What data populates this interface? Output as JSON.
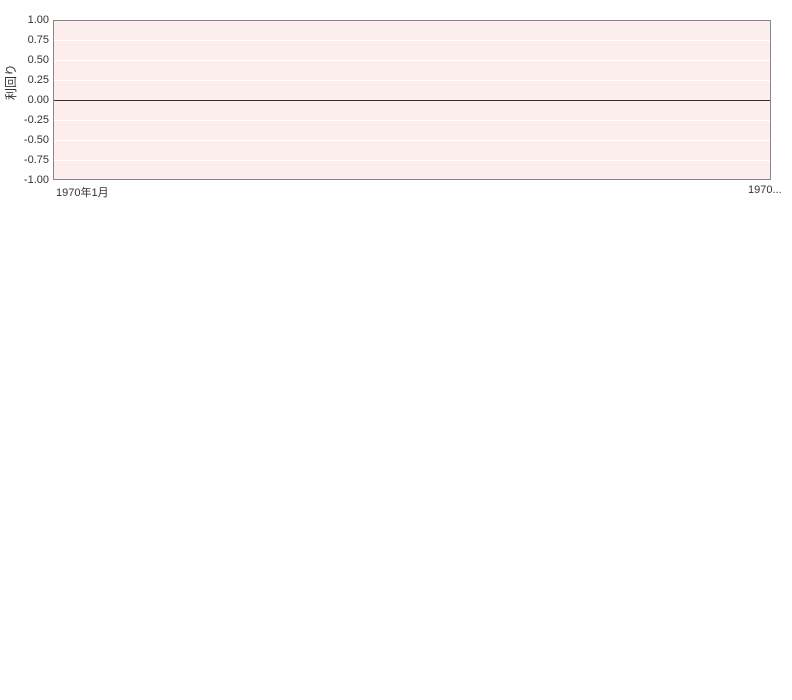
{
  "chart_data": {
    "type": "line",
    "title": "",
    "xlabel": "",
    "ylabel": "利回り",
    "ylim": [
      -1.0,
      1.0
    ],
    "y_ticks": [
      1.0,
      0.75,
      0.5,
      0.25,
      0.0,
      -0.25,
      -0.5,
      -0.75,
      -1.0
    ],
    "x_tick_labels": [
      "1970年1月",
      "1970..."
    ],
    "series": [
      {
        "name": "",
        "x": [],
        "values": []
      }
    ]
  }
}
